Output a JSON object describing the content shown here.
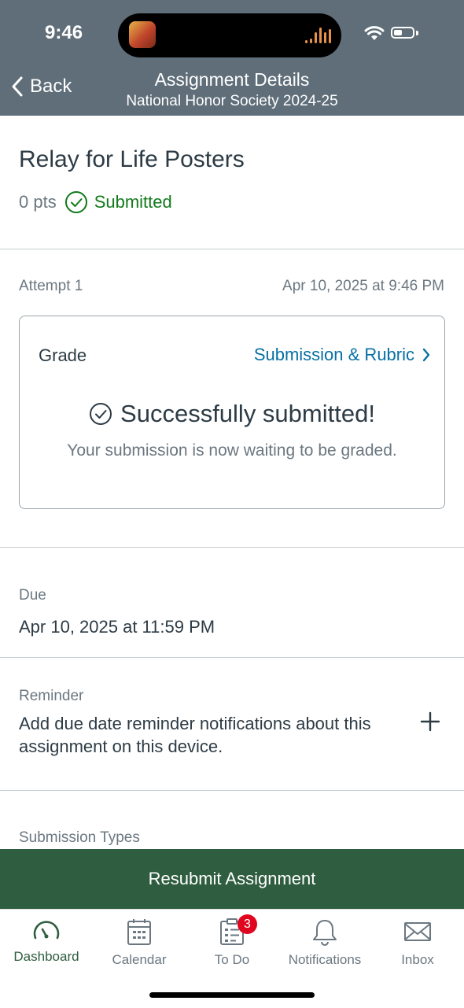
{
  "status_bar": {
    "time": "9:46"
  },
  "nav": {
    "back_label": "Back",
    "title": "Assignment Details",
    "subtitle": "National Honor Society 2024-25"
  },
  "assignment": {
    "title": "Relay for Life Posters",
    "points": "0 pts",
    "status": "Submitted"
  },
  "attempt": {
    "label": "Attempt 1",
    "date": "Apr 10, 2025 at 9:46 PM"
  },
  "grade_card": {
    "label": "Grade",
    "link": "Submission & Rubric",
    "success_title": "Successfully submitted!",
    "success_message": "Your submission is now waiting to be graded."
  },
  "due": {
    "label": "Due",
    "value": "Apr 10, 2025 at 11:59 PM"
  },
  "reminder": {
    "label": "Reminder",
    "text": "Add due date reminder notifications about this assignment on this device."
  },
  "submission_types": {
    "label": "Submission Types"
  },
  "resubmit_button": "Resubmit Assignment",
  "tabs": [
    {
      "label": "Dashboard",
      "icon": "dashboard-icon",
      "active": true
    },
    {
      "label": "Calendar",
      "icon": "calendar-icon"
    },
    {
      "label": "To Do",
      "icon": "todo-icon",
      "badge": "3"
    },
    {
      "label": "Notifications",
      "icon": "bell-icon"
    },
    {
      "label": "Inbox",
      "icon": "envelope-icon"
    }
  ],
  "colors": {
    "header": "#5f6e79",
    "success": "#127a1b",
    "link": "#0770a3",
    "brand": "#2f5d3f",
    "badge": "#e0061f"
  }
}
